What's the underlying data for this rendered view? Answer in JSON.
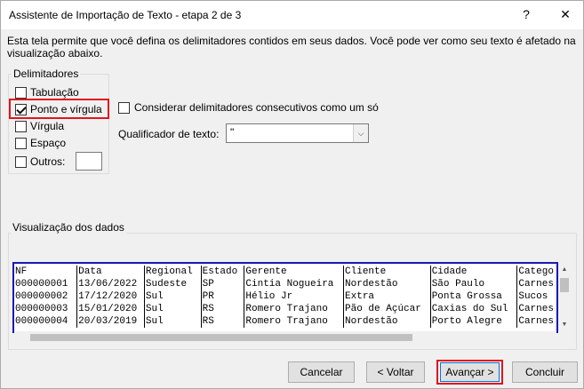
{
  "window": {
    "title": "Assistente de Importação de Texto - etapa 2 de 3",
    "help_glyph": "?",
    "close_glyph": "✕"
  },
  "description": "Esta tela permite que você defina os delimitadores contidos em seus dados. Você pode ver como seu texto é afetado na visualização abaixo.",
  "delimiters": {
    "legend": "Delimitadores",
    "items": [
      {
        "label": "Tabulação",
        "checked": false
      },
      {
        "label": "Ponto e vírgula",
        "checked": true
      },
      {
        "label": "Vírgula",
        "checked": false
      },
      {
        "label": "Espaço",
        "checked": false
      },
      {
        "label": "Outros:",
        "checked": false
      }
    ],
    "other_value": ""
  },
  "consecutive": {
    "label": "Considerar delimitadores consecutivos como um só",
    "checked": false
  },
  "qualifier": {
    "label": "Qualificador de texto:",
    "value": "\"",
    "arrow_glyph": "⌵"
  },
  "preview": {
    "legend": "Visualização dos dados",
    "headers": [
      "NF",
      "Data",
      "Regional",
      "Estado",
      "Gerente",
      "Cliente",
      "Cidade",
      "Catego"
    ],
    "rows": [
      [
        "000000001",
        "13/06/2022",
        "Sudeste",
        "SP",
        "Cintia Nogueira",
        "Nordestão",
        "São Paulo",
        "Carnes"
      ],
      [
        "000000002",
        "17/12/2020",
        "Sul",
        "PR",
        "Hélio Jr",
        "Extra",
        "Ponta Grossa",
        "Sucos"
      ],
      [
        "000000003",
        "15/01/2020",
        "Sul",
        "RS",
        "Romero Trajano",
        "Pão de Açúcar",
        "Caxias do Sul",
        "Carnes"
      ],
      [
        "000000004",
        "20/03/2019",
        "Sul",
        "RS",
        "Romero Trajano",
        "Nordestão",
        "Porto Alegre",
        "Carnes"
      ]
    ]
  },
  "buttons": {
    "cancel": "Cancelar",
    "back": "< Voltar",
    "next": "Avançar >",
    "finish": "Concluir"
  },
  "colors": {
    "highlight_red": "#e0141e",
    "highlight_blue": "#1a1ab4"
  }
}
